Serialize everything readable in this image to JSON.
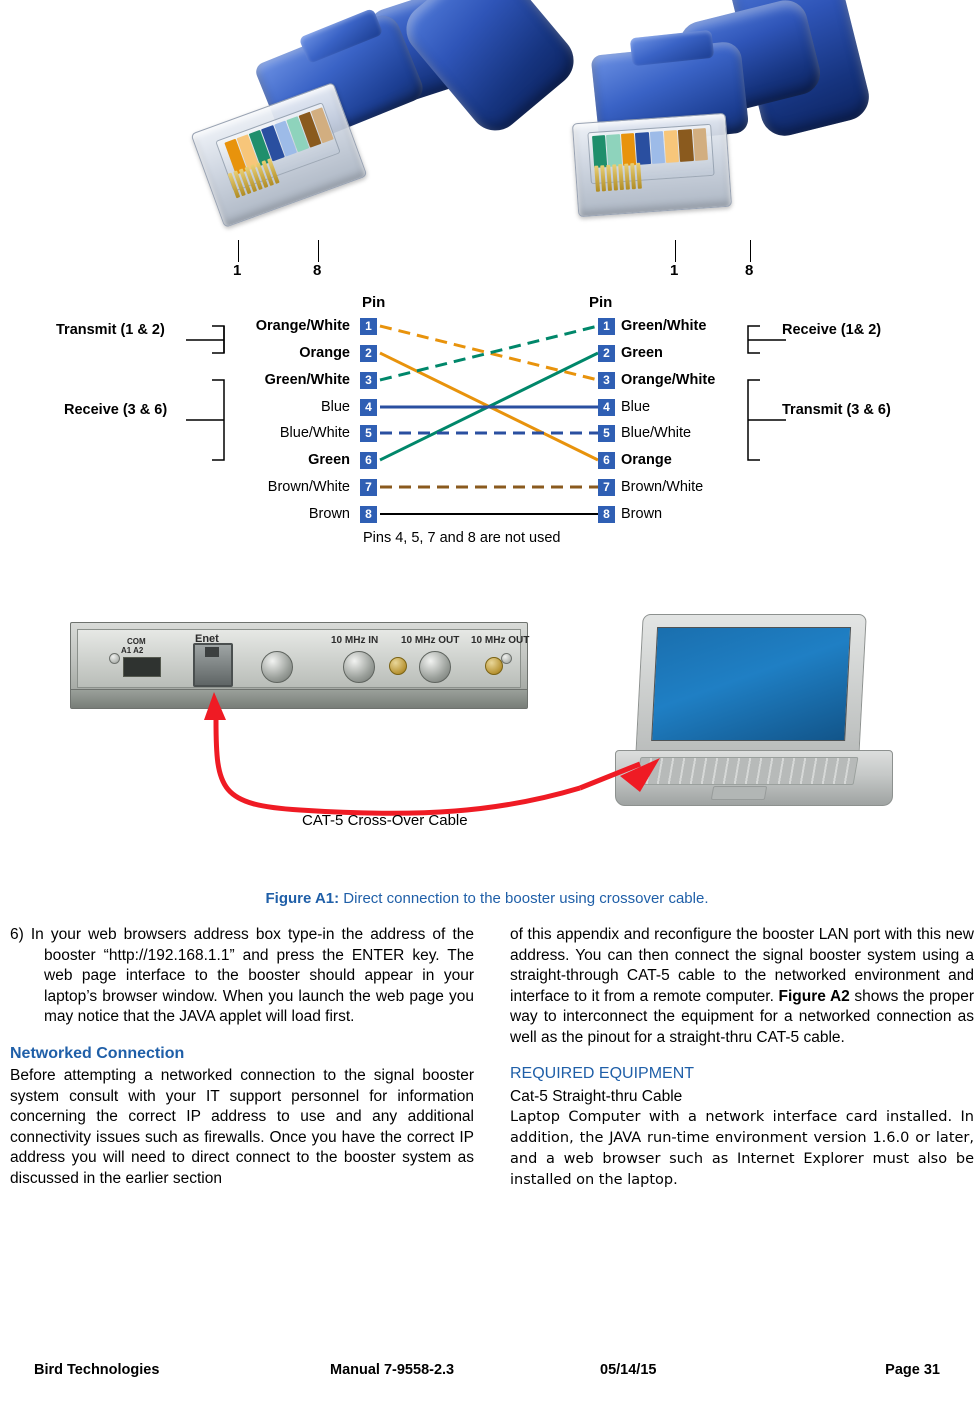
{
  "connector_photos": {
    "left": {
      "pin_first": "1",
      "pin_last": "8"
    },
    "right": {
      "pin_first": "1",
      "pin_last": "8"
    }
  },
  "pinout": {
    "header_left": "Pin",
    "header_right": "Pin",
    "not_used_note": "Pins 4, 5, 7 and 8 are not used",
    "left_brackets": [
      {
        "label": "Transmit (1 & 2)"
      },
      {
        "label": "Receive (3 & 6)"
      }
    ],
    "right_brackets": [
      {
        "label": "Receive (1& 2)"
      },
      {
        "label": "Transmit (3 & 6)"
      }
    ],
    "left_pins": [
      {
        "num": "1",
        "label": "Orange/White",
        "bold": true
      },
      {
        "num": "2",
        "label": "Orange",
        "bold": true
      },
      {
        "num": "3",
        "label": "Green/White",
        "bold": true
      },
      {
        "num": "4",
        "label": "Blue",
        "bold": false
      },
      {
        "num": "5",
        "label": "Blue/White",
        "bold": false
      },
      {
        "num": "6",
        "label": "Green",
        "bold": true
      },
      {
        "num": "7",
        "label": "Brown/White",
        "bold": false
      },
      {
        "num": "8",
        "label": "Brown",
        "bold": false
      }
    ],
    "right_pins": [
      {
        "num": "1",
        "label": "Green/White",
        "bold": true
      },
      {
        "num": "2",
        "label": "Green",
        "bold": true
      },
      {
        "num": "3",
        "label": "Orange/White",
        "bold": true
      },
      {
        "num": "4",
        "label": "Blue",
        "bold": false
      },
      {
        "num": "5",
        "label": "Blue/White",
        "bold": false
      },
      {
        "num": "6",
        "label": "Orange",
        "bold": true
      },
      {
        "num": "7",
        "label": "Brown/White",
        "bold": false
      },
      {
        "num": "8",
        "label": "Brown",
        "bold": false
      }
    ],
    "colors": {
      "pin_box": "#2f5fb4",
      "green_wire": "#00876a",
      "orange_wire": "#e8930c",
      "blue_wire": "#2a4fa0",
      "brown_wire": "#8a5a1e",
      "black_wire": "#000000"
    }
  },
  "figure2": {
    "booster_labels": {
      "com": "COM",
      "com_sub": "A1   A2",
      "enet": "Enet",
      "mhz_in": "10 MHz IN",
      "mhz_out1": "10 MHz OUT",
      "mhz_out2": "10 MHz OUT"
    },
    "cable_label": "CAT-5 Cross-Over Cable"
  },
  "figure_caption": {
    "label": "Figure A1:",
    "text": "Direct connection to the booster using crossover cable."
  },
  "body": {
    "left": {
      "item6": "6)   In your web browsers address box type-in the address of the booster “http://192.168.1.1” and press the ENTER key. The web page interface to the booster should appear in your laptop’s browser window. When you launch the web page you may notice that the JAVA applet will load first.",
      "heading": "Networked Connection",
      "paragraph": "Before attempting a networked connection to the signal booster system consult with your IT support personnel for information concerning the correct IP address to use and any additional connectivity issues such as firewalls. Once you have the correct IP address you will need to direct connect to the booster system as discussed in the earlier section"
    },
    "right": {
      "paragraph_a": "of this appendix and reconfigure the booster LAN port with this new address. You can then connect the signal booster system using a straight-through CAT-5 cable to the networked environment and interface to it from a remote computer. ",
      "paragraph_a_bold": "Figure A2",
      "paragraph_a_cont": " shows the proper way to interconnect the equipment for a networked connection as well as the pinout for a straight-thru CAT-5 cable.",
      "heading": "REQUIRED EQUIPMENT",
      "equipment_line1": "Cat-5 Straight-thru Cable",
      "equipment_line2": "Laptop Computer with a network interface card installed. In addition, the JAVA run-time environment version 1.6.0 or later, and a web browser such as Internet Explorer must also be installed on the laptop."
    }
  },
  "footer": {
    "company": "Bird Technologies",
    "manual": "Manual 7-9558-2.3",
    "date": "05/14/15",
    "page": "Page 31"
  }
}
